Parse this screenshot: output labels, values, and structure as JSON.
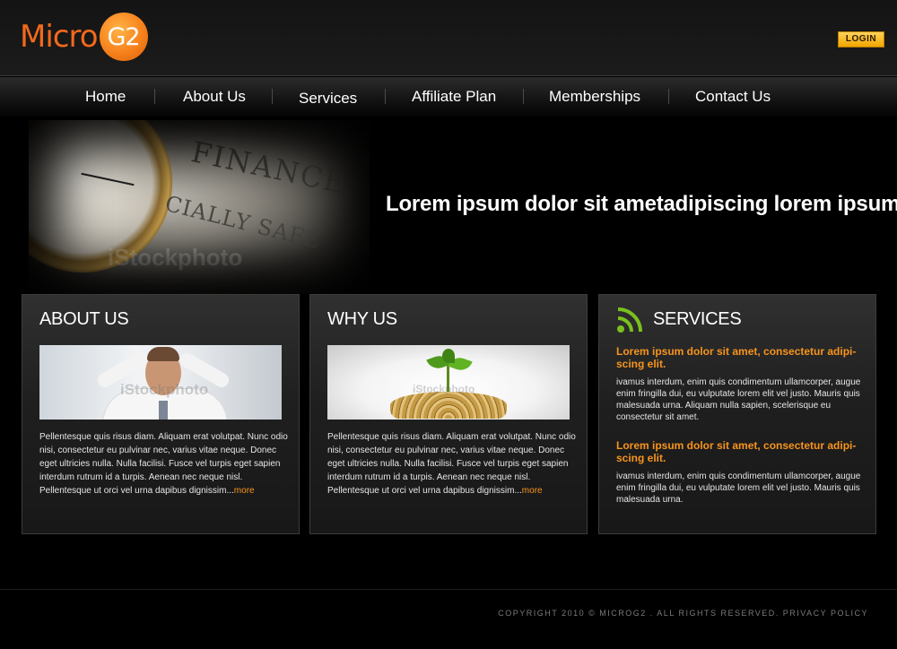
{
  "header": {
    "logo_text": "Micro",
    "logo_badge": "G2",
    "login_label": "LOGIN"
  },
  "nav": {
    "items": [
      "Home",
      "About Us",
      "Services",
      "Affiliate Plan",
      "Memberships",
      "Contact Us"
    ]
  },
  "banner": {
    "headline": "Lorem ipsum dolor sit ametadipiscing lorem ipsum",
    "image_words": [
      "FINANCE",
      "CIALLY SAFE"
    ],
    "image_watermark": "iStockphoto"
  },
  "about": {
    "title": "ABOUT US",
    "image_watermark": "iStockphoto",
    "body": "Pellentesque quis risus diam. Aliquam erat volutpat. Nunc odio nisi, consectetur eu pulvinar nec, varius vitae neque. Donec eget ultricies nulla. Nulla facilisi. Fusce vel turpis eget sapien interdum rutrum id a turpis. Aenean nec neque nisl. Pellentesque ut orci vel urna dapibus dignissim...",
    "more_label": "more"
  },
  "why": {
    "title": "WHY US",
    "image_watermark": "iStockphoto",
    "body": "Pellentesque quis risus diam. Aliquam erat volutpat. Nunc odio nisi, consectetur eu pulvinar nec, varius vitae neque. Donec eget ultricies nulla. Nulla facilisi. Fusce vel turpis eget sapien interdum rutrum id a turpis. Aenean nec neque nisl. Pellentesque ut orci vel urna dapibus dignissim...",
    "more_label": "more"
  },
  "services": {
    "title": "SERVICES",
    "icon": "rss-icon",
    "items": [
      {
        "heading": "Lorem ipsum dolor sit amet, consectetur adipi-scing elit.",
        "text": "ivamus interdum, enim quis condimentum ullamcorper, augue enim fringilla dui, eu vulputate lorem elit vel justo. Mauris quis malesuada urna. Aliquam nulla sapien, scelerisque eu consectetur sit amet."
      },
      {
        "heading": "Lorem ipsum dolor sit amet, consectetur adipi-scing elit.",
        "text": "ivamus interdum, enim quis condimentum ullamcorper, augue enim fringilla dui, eu vulputate lorem elit vel justo. Mauris quis malesuada urna."
      }
    ]
  },
  "footer": {
    "copyright": "COPYRIGHT 2010 © MICROG2 . ALL RIGHTS RESERVED. PRIVACY POLICY"
  },
  "colors": {
    "accent_orange": "#f7941d",
    "background": "#000000",
    "rss_green": "#7ac11e",
    "login_yellow": "#f3a500"
  }
}
